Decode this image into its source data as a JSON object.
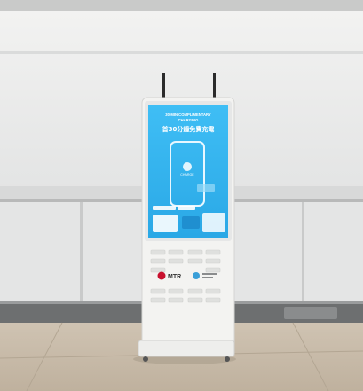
{
  "kiosk": {
    "screen": {
      "headline_en_line1": "30-MIN COMPLIMENTARY",
      "headline_en_line2": "CHARGING",
      "headline_zh": "首30分鐘免費充電",
      "phone_label": "CHARGE"
    },
    "body": {
      "brand": "MTR"
    }
  },
  "colors": {
    "wall": "#e9eaea",
    "screen_blue": "#2fb3ef",
    "kiosk_white": "#f3f3f1",
    "floor": "#c8bba8",
    "mtr_red": "#c8102e"
  }
}
